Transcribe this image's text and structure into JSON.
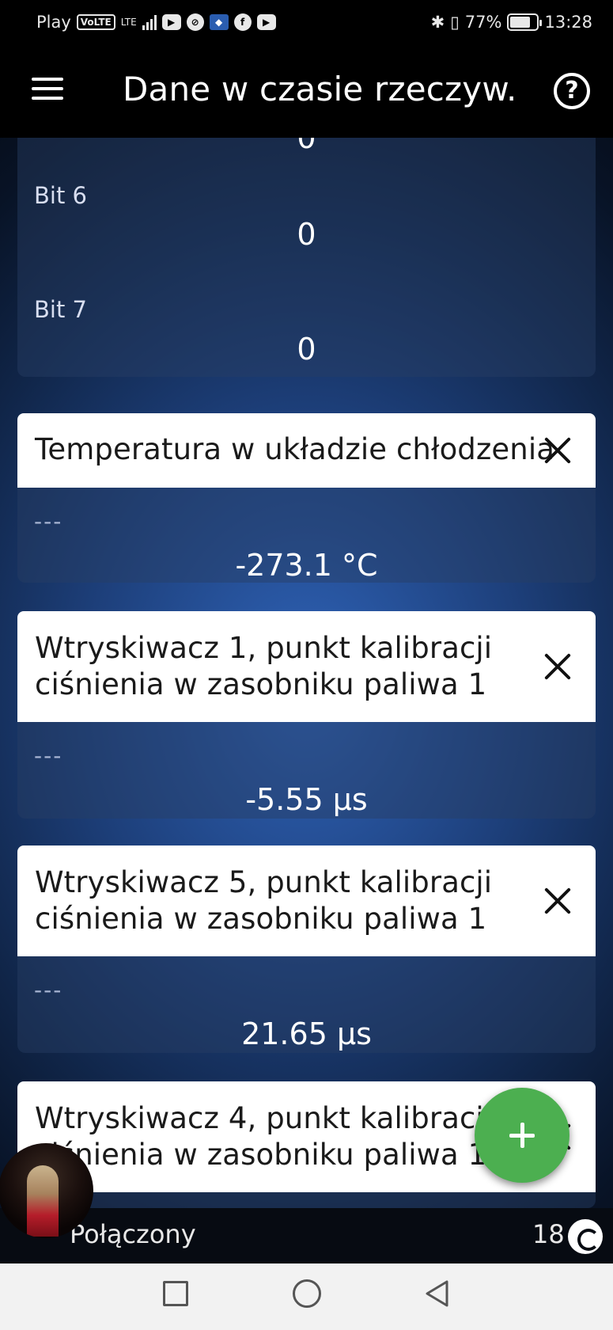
{
  "status_bar": {
    "carrier": "Play",
    "volte": "VoLTE",
    "lte": "LTE",
    "battery_percent": "77%",
    "battery_level": 0.77,
    "time": "13:28",
    "icons": [
      "youtube-icon",
      "no-disturb-icon",
      "app-icon",
      "facebook-icon",
      "youtube-icon",
      "bluetooth-icon",
      "vibrate-icon"
    ]
  },
  "app_bar": {
    "title": "Dane w czasie rzeczyw...",
    "menu_icon": "hamburger-menu-icon",
    "help_icon": "help-icon",
    "help_glyph": "?"
  },
  "top_panel": {
    "cut_value": "0",
    "rows": [
      {
        "label": "Bit 6",
        "value": "0"
      },
      {
        "label": "Bit 7",
        "value": "0"
      }
    ]
  },
  "cards": [
    {
      "title_lines": [
        "Temperatura w układzie chłodzenia"
      ],
      "dash": "---",
      "value": "-273.1 °C"
    },
    {
      "title_lines": [
        "Wtryskiwacz 1, punkt kalibracji",
        "ciśnienia w zasobniku paliwa 1"
      ],
      "dash": "---",
      "value": "-5.55 µs"
    },
    {
      "title_lines": [
        "Wtryskiwacz 5, punkt kalibracji",
        "ciśnienia w zasobniku paliwa 1"
      ],
      "dash": "---",
      "value": "21.65 µs"
    },
    {
      "title_lines": [
        "Wtryskiwacz 4, punkt kalibracji",
        "ciśnienia w zasobniku paliwa 1"
      ]
    }
  ],
  "fab": {
    "icon": "add-icon"
  },
  "bottom_bar": {
    "connection_status": "Połączony",
    "count": "18",
    "sync_icon": "sync-icon"
  },
  "nav_bar": {
    "icons": [
      "recent-apps-icon",
      "home-icon",
      "back-icon"
    ]
  },
  "colors": {
    "background_accent": "#2f63b8",
    "fab": "#4caf50",
    "card_header": "#ffffff",
    "bar": "#000000"
  }
}
